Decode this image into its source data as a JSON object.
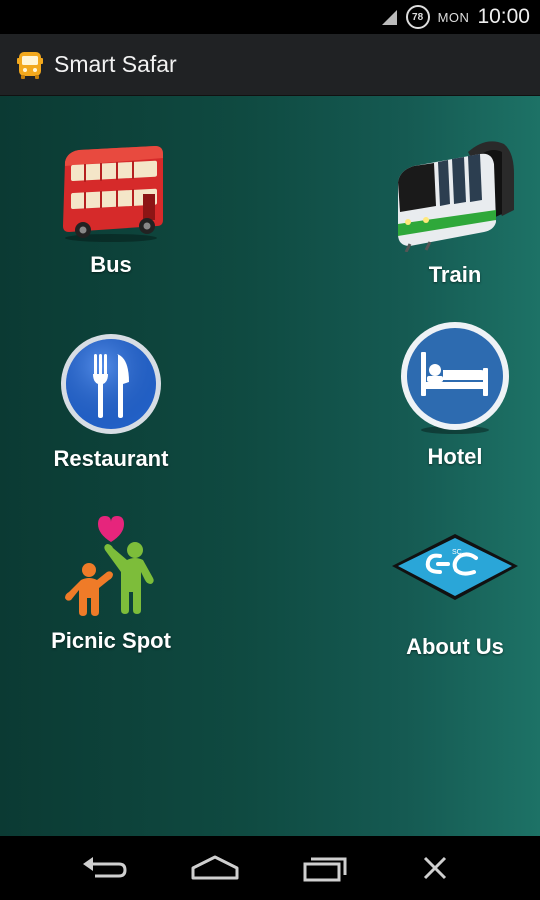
{
  "status_bar": {
    "battery_level": "78",
    "day": "MON",
    "time": "10:00"
  },
  "app": {
    "title": "Smart Safar"
  },
  "tiles": [
    {
      "label": "Bus",
      "icon": "bus-icon"
    },
    {
      "label": "Train",
      "icon": "train-icon"
    },
    {
      "label": "Restaurant",
      "icon": "restaurant-icon"
    },
    {
      "label": "Hotel",
      "icon": "hotel-icon"
    },
    {
      "label": "Picnic Spot",
      "icon": "picnic-icon"
    },
    {
      "label": "About Us",
      "icon": "about-logo-icon"
    }
  ],
  "nav": {
    "back": "back-icon",
    "home": "home-icon",
    "recents": "recents-icon",
    "close": "close-icon"
  },
  "colors": {
    "background_start": "#0b3a33",
    "background_end": "#1d7266",
    "action_bar": "#202224"
  }
}
